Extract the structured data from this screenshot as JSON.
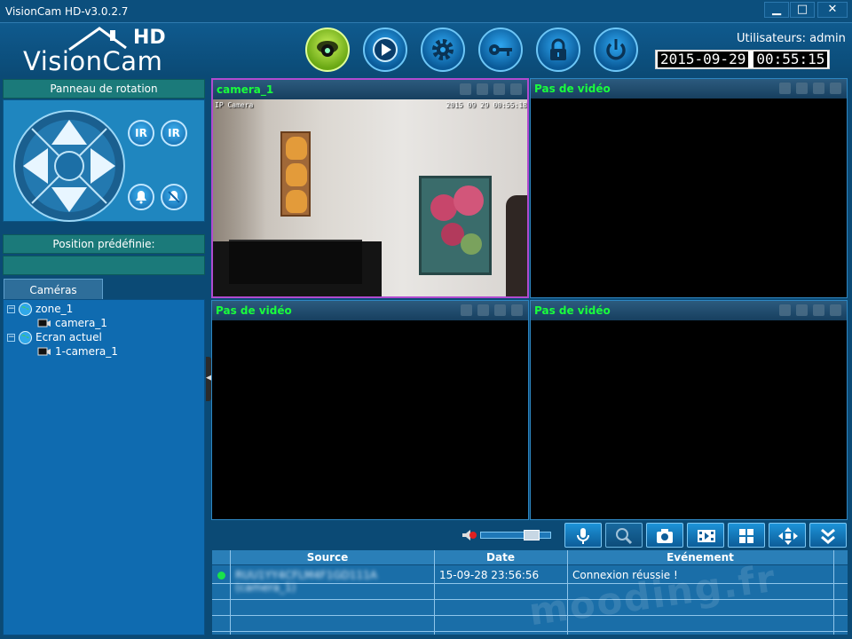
{
  "window": {
    "title": "VisionCam HD-v3.0.2.7",
    "controls": {
      "minimize": "▁",
      "maximize": "□",
      "close": "✕"
    }
  },
  "logo": {
    "wordmark": "VisionCam",
    "badge": "HD"
  },
  "toolbar": {
    "buttons": [
      {
        "icon": "camera-dome-icon",
        "active": true
      },
      {
        "icon": "play-icon",
        "active": false
      },
      {
        "icon": "gear-icon",
        "active": false
      },
      {
        "icon": "key-icon",
        "active": false
      },
      {
        "icon": "lock-icon",
        "active": false
      },
      {
        "icon": "power-icon",
        "active": false
      }
    ]
  },
  "session": {
    "users_label": "Utilisateurs: admin",
    "date": "2015-09-29",
    "time": "00:55:15"
  },
  "left_panel": {
    "rotation_title": "Panneau de rotation",
    "ir_on": "IR",
    "ir_off": "IR",
    "preset_title": "Position prédéfinie:",
    "cameras_tab": "Caméras",
    "tree": [
      {
        "label": "zone_1",
        "toggle": "−",
        "icon": "globe-icon"
      },
      {
        "label": "camera_1",
        "icon": "camera-icon"
      },
      {
        "label": "Ecran actuel",
        "toggle": "−",
        "icon": "globe-icon"
      },
      {
        "label": "1-camera_1",
        "icon": "camera-icon"
      }
    ]
  },
  "video_panes": [
    {
      "title": "camera_1",
      "osd_left": "IP Camera",
      "osd_right": "2015 09 29 00:55:18",
      "has_video": true
    },
    {
      "title": "Pas de vidéo",
      "has_video": false
    },
    {
      "title": "Pas de vidéo",
      "has_video": false
    },
    {
      "title": "Pas de vidéo",
      "has_video": false
    }
  ],
  "controls_bar": {
    "volume_level": 0.8,
    "buttons": [
      "microphone-icon",
      "zoom-icon",
      "snapshot-icon",
      "record-icon",
      "grid-layout-icon",
      "ptz-arrows-icon",
      "collapse-down-icon"
    ]
  },
  "event_log": {
    "columns": [
      "Source",
      "Date",
      "Evénement"
    ],
    "rows": [
      {
        "source": "RUU1YY4CFLM4F1GD111A (camera_1)",
        "date": "15-09-28 23:56:56",
        "event": "Connexion réussie !",
        "status_color": "#19e34a"
      }
    ]
  },
  "watermark": "mooding.fr",
  "colors": {
    "accent_green": "#19ff3c",
    "panel_teal": "#1b7a7a",
    "selected_border": "#b04bd0"
  }
}
